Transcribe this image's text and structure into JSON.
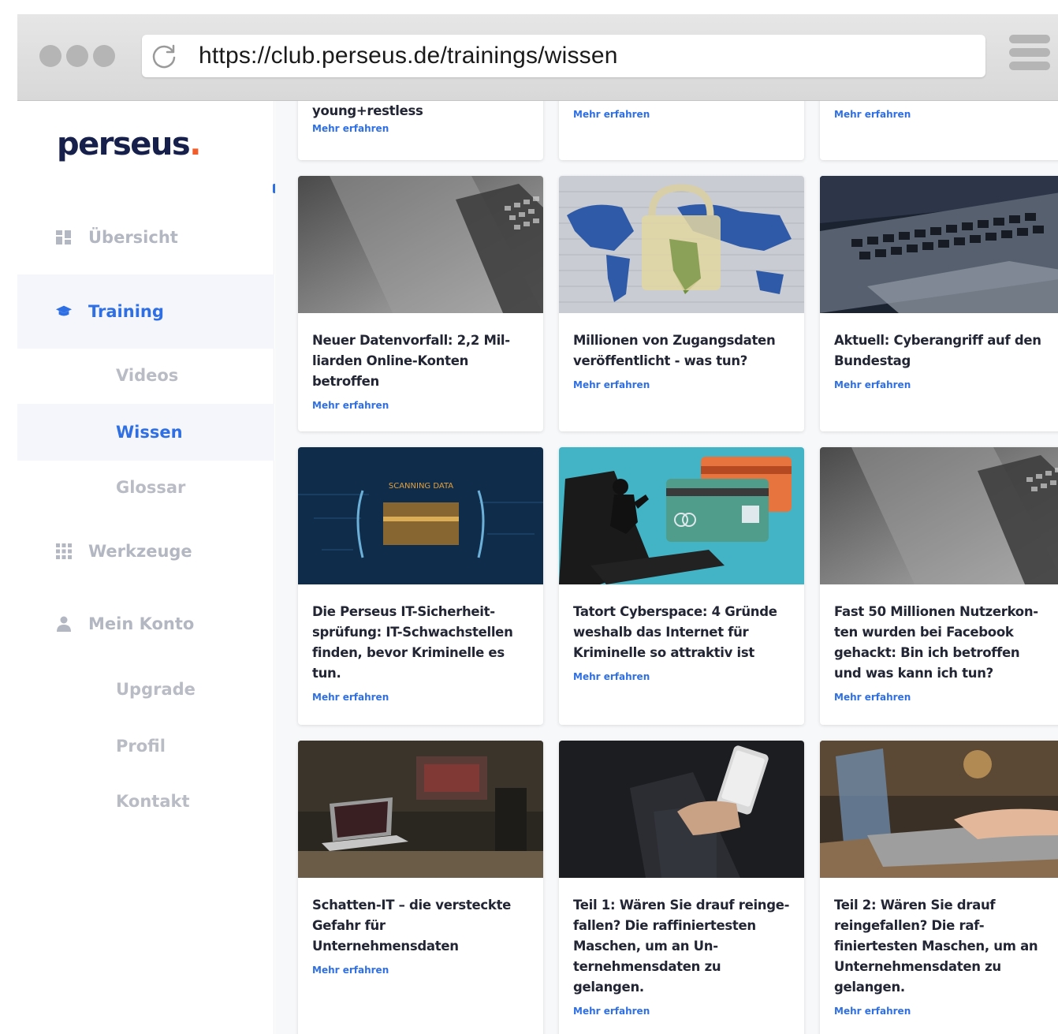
{
  "browser": {
    "url": "https://club.perseus.de/trainings/wissen"
  },
  "sidebar": {
    "logo_text": "perseus",
    "logo_dot": ".",
    "items": [
      {
        "label": "Übersicht",
        "icon": "dashboard-icon",
        "active": false
      },
      {
        "label": "Training",
        "icon": "graduation-cap-icon",
        "active": true
      },
      {
        "label": "Werkzeuge",
        "icon": "grid-icon",
        "active": false
      },
      {
        "label": "Mein Konto",
        "icon": "user-icon",
        "active": false
      }
    ],
    "training_sub": [
      {
        "label": "Videos",
        "active": false
      },
      {
        "label": "Wissen",
        "active": true
      },
      {
        "label": "Glossar",
        "active": false
      }
    ],
    "account_sub": [
      {
        "label": "Upgrade"
      },
      {
        "label": "Profil"
      },
      {
        "label": "Kontakt"
      }
    ]
  },
  "cards_partial": [
    {
      "title": "young+restless",
      "link": "Mehr erfahren"
    },
    {
      "title": "",
      "link": "Mehr erfahren"
    },
    {
      "title": "",
      "link": "Mehr erfahren"
    }
  ],
  "cards": [
    {
      "title": "Neuer Datenvorfall: 2,2 Mil-\nliarden Online-Konten\nbetroffen",
      "link": "Mehr erfahren",
      "image": "laptop-gray"
    },
    {
      "title": "Millionen von Zugangsdaten\nveröffentlicht - was tun?",
      "link": "Mehr erfahren",
      "image": "world-map-padlock"
    },
    {
      "title": "Aktuell: Cyberangriff auf den\nBundestag",
      "link": "Mehr erfahren",
      "image": "laptop-keyboard-blue"
    },
    {
      "title": "Die Perseus IT-Sicherheit-\nsprüfung: IT-Schwachstellen\nfinden, bevor Kriminelle es\ntun.",
      "link": "Mehr erfahren",
      "image": "scanning-data",
      "image_text": "SCANNING DATA"
    },
    {
      "title": "Tatort Cyberspace: 4 Gründe\nweshalb das Internet für\nKriminelle so attraktiv ist",
      "link": "Mehr erfahren",
      "image": "hacker-credit-card"
    },
    {
      "title": "Fast 50 Millionen Nutzerkon-\nten wurden bei Facebook\ngehackt: Bin ich betroffen\nund was kann ich tun?",
      "link": "Mehr erfahren",
      "image": "laptop-gray"
    },
    {
      "title": "Schatten-IT – die versteckte\nGefahr für\nUnternehmensdaten",
      "link": "Mehr erfahren",
      "image": "dark-desk-laptop"
    },
    {
      "title": "Teil 1: Wären Sie drauf reinge-\nfallen? Die raffiniertesten\nMaschen, um an Un-\nternehmensdaten zu\ngelangen.",
      "link": "Mehr erfahren",
      "image": "hand-smartphone"
    },
    {
      "title": "Teil 2: Wären Sie drauf\nreingefallen? Die raf-\nfiniertesten Maschen, um an\nUnternehmensdaten zu\ngelangen.",
      "link": "Mehr erfahren",
      "image": "typing-laptop-warm"
    }
  ],
  "colors": {
    "accent": "#2f6fe4",
    "logo_navy": "#16204a",
    "logo_orange": "#f25c2a",
    "muted_nav": "#b3b7c1"
  }
}
